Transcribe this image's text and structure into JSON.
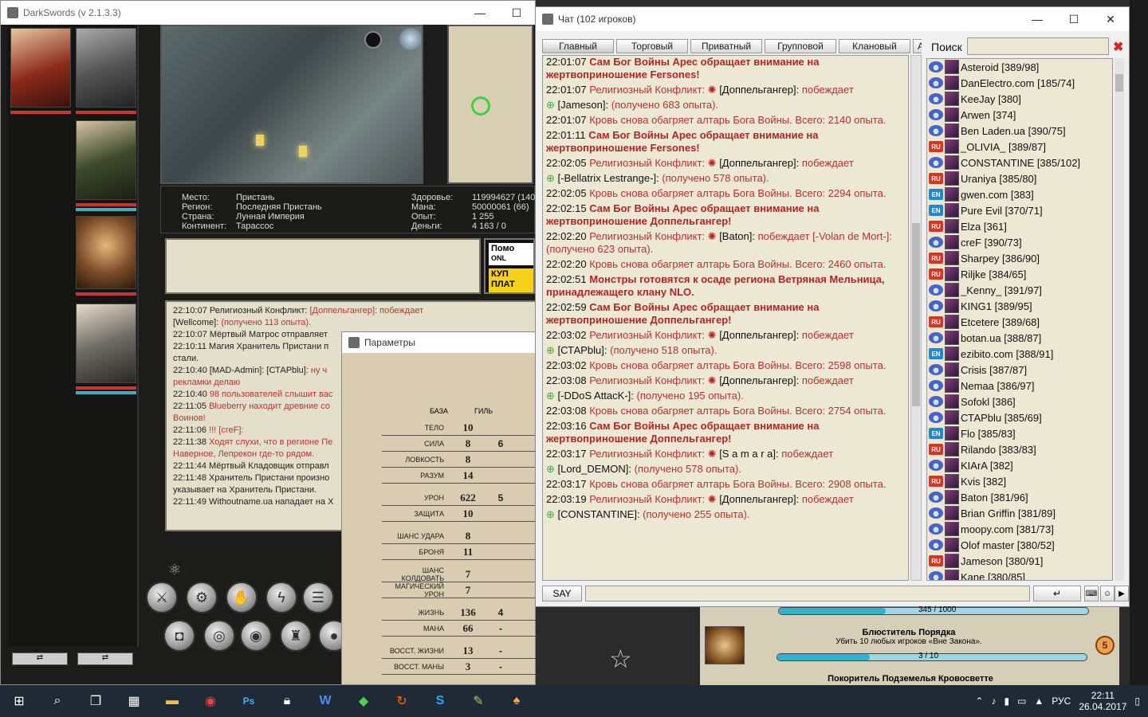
{
  "game": {
    "title": "DarkSwords (v 2.1.3.3)",
    "info": {
      "place_label": "Место:",
      "place": "Пристань",
      "region_label": "Регион:",
      "region": "Последняя Пристань",
      "country_label": "Страна:",
      "country": "Лунная Империя",
      "continent_label": "Континент:",
      "continent": "Тарассос",
      "health_label": "Здоровье:",
      "health": "119994627 (140)",
      "mana_label": "Мана:",
      "mana": "50000061 (66)",
      "exp_label": "Опыт:",
      "exp": "1 255",
      "money_label": "Деньги:",
      "money": "4 163 / 0"
    },
    "shop": {
      "line1": "Помо",
      "line2": "ONL",
      "line3": "КУП",
      "line4": "ПЛАТ"
    },
    "log": [
      {
        "text": "22:10:07 Религиозный Конфликт: ",
        "red": "[Доппельгангер]: побеждает"
      },
      {
        "text": "[Wellcome]: ",
        "red": "(получено 113 опыта)."
      },
      {
        "text": "22:10:07 Мёртвый Матрос отправляет",
        "red": ""
      },
      {
        "text": "22:10:11 Магия Хранитель Пристани п",
        "red": ""
      },
      {
        "text": "стали.",
        "red": ""
      },
      {
        "text": "22:10:40 [MAD-Admin]: [СТАРblu]: ",
        "red": "ну ч"
      },
      {
        "text": "",
        "red": "рекламки делаю"
      },
      {
        "text": "22:10:40 ",
        "red": "98 пользователей слышит вас"
      },
      {
        "text": "22:11:05 ",
        "red": "Blueberry находит древние со"
      },
      {
        "text": "",
        "red": "Воинов!"
      },
      {
        "text": "22:11:06 ",
        "red": "!!! [creF]:"
      },
      {
        "text": "22:11:38 ",
        "red": "Ходят слухи, что в регионе Пе"
      },
      {
        "text": "",
        "red": "Наверное, Лепрекон где-то рядом."
      },
      {
        "text": "22:11:44 Мёртвый Кладовщик отправл",
        "red": ""
      },
      {
        "text": "22:11:48 Хранитель Пристани произно",
        "red": ""
      },
      {
        "text": "указывает на Хранитель Пристани.",
        "red": ""
      },
      {
        "text": "22:11:49 Withoutname.ua нападает на Х",
        "red": ""
      }
    ]
  },
  "params": {
    "title": "Параметры",
    "col_base": "БАЗА",
    "col_guild": "ГИЛЬ",
    "rows": [
      {
        "label": "ТЕЛО",
        "base": "10",
        "guild": ""
      },
      {
        "label": "СИЛА",
        "base": "8",
        "guild": "6"
      },
      {
        "label": "ЛОВКОСТЬ",
        "base": "8",
        "guild": ""
      },
      {
        "label": "РАЗУМ",
        "base": "14",
        "guild": ""
      },
      {
        "label": "",
        "base": "",
        "guild": ""
      },
      {
        "label": "УРОН",
        "base": "622",
        "guild": "5"
      },
      {
        "label": "ЗАЩИТА",
        "base": "10",
        "guild": ""
      },
      {
        "label": "",
        "base": "",
        "guild": ""
      },
      {
        "label": "ШАНС УДАРА",
        "base": "8",
        "guild": ""
      },
      {
        "label": "БРОНЯ",
        "base": "11",
        "guild": ""
      },
      {
        "label": "",
        "base": "",
        "guild": ""
      },
      {
        "label": "ШАНС КОЛДОВАТЬ",
        "base": "7",
        "guild": ""
      },
      {
        "label": "МАГИЧЕСКИЙ УРОН",
        "base": "7",
        "guild": ""
      },
      {
        "label": "",
        "base": "",
        "guild": ""
      },
      {
        "label": "ЖИЗНЬ",
        "base": "136",
        "guild": "4"
      },
      {
        "label": "МАНА",
        "base": "66",
        "guild": "-"
      },
      {
        "label": "",
        "base": "",
        "guild": ""
      },
      {
        "label": "ВОССТ. ЖИЗНИ",
        "base": "13",
        "guild": "-"
      },
      {
        "label": "ВОССТ. МАНЫ",
        "base": "3",
        "guild": "-"
      }
    ]
  },
  "chat": {
    "title": "Чат (102 игроков)",
    "tabs": [
      "Главный",
      "Торговый",
      "Приватный",
      "Групповой",
      "Клановый",
      "А"
    ],
    "search_label": "Поиск",
    "say_label": "SAY",
    "messages": [
      {
        "time": "22:01:07",
        "kind": "red",
        "text": "Сам Бог Войны Арес обращает внимание на жертвоприношение Fersones!"
      },
      {
        "time": "22:01:07",
        "kind": "dark",
        "text": "Религиозный Конфликт:",
        "name": "[Доппельгангер]:",
        "tail": "побеждает"
      },
      {
        "time": "",
        "kind": "dark",
        "text": "",
        "name": "[Jameson]:",
        "tail": "(получено 683 опыта)."
      },
      {
        "time": "22:01:07",
        "kind": "dark",
        "text": "Кровь снова обагряет алтарь Бога Войны. Всего: 2140 опыта."
      },
      {
        "time": "22:01:11",
        "kind": "red",
        "text": "Сам Бог Войны Арес обращает внимание на жертвоприношение Fersones!"
      },
      {
        "time": "22:02:05",
        "kind": "dark",
        "text": "Религиозный Конфликт:",
        "name": "[Доппельгангер]:",
        "tail": "побеждает"
      },
      {
        "time": "",
        "kind": "dark",
        "text": "",
        "name": "[-Bellatrix Lestrange-]:",
        "tail": "(получено 578 опыта)."
      },
      {
        "time": "22:02:05",
        "kind": "dark",
        "text": "Кровь снова обагряет алтарь Бога Войны. Всего: 2294 опыта."
      },
      {
        "time": "22:02:15",
        "kind": "red",
        "text": "Сам Бог Войны Арес обращает внимание на жертвоприношение Доппельгангер!"
      },
      {
        "time": "22:02:20",
        "kind": "dark",
        "text": "Религиозный Конфликт:",
        "name": "[Baton]:",
        "tail": "побеждает [-Volan de Mort-]: (получено 623 опыта)."
      },
      {
        "time": "22:02:20",
        "kind": "dark",
        "text": "Кровь снова обагряет алтарь Бога Войны. Всего: 2460 опыта."
      },
      {
        "time": "22:02:51",
        "kind": "red",
        "text": "Монстры готовятся к осаде региона Ветряная Мельница, принадлежащего клану NLO."
      },
      {
        "time": "22:02:59",
        "kind": "red",
        "text": "Сам Бог Войны Арес обращает внимание на жертвоприношение Доппельгангер!"
      },
      {
        "time": "22:03:02",
        "kind": "dark",
        "text": "Религиозный Конфликт:",
        "name": "[Доппельгангер]:",
        "tail": "побеждает"
      },
      {
        "time": "",
        "kind": "dark",
        "text": "",
        "name": "[СТАРblu]:",
        "tail": "(получено 518 опыта)."
      },
      {
        "time": "22:03:02",
        "kind": "dark",
        "text": "Кровь снова обагряет алтарь Бога Войны. Всего: 2598 опыта."
      },
      {
        "time": "22:03:08",
        "kind": "dark",
        "text": "Религиозный Конфликт:",
        "name": "[Доппельгангер]:",
        "tail": "побеждает"
      },
      {
        "time": "",
        "kind": "dark",
        "text": "",
        "name": "[-DDoS AttacK-]:",
        "tail": "(получено 195 опыта)."
      },
      {
        "time": "22:03:08",
        "kind": "dark",
        "text": "Кровь снова обагряет алтарь Бога Войны. Всего: 2754 опыта."
      },
      {
        "time": "22:03:16",
        "kind": "red",
        "text": "Сам Бог Войны Арес обращает внимание на жертвоприношение Доппельгангер!"
      },
      {
        "time": "22:03:17",
        "kind": "dark",
        "text": "Религиозный Конфликт:",
        "name": "[S a m a r a]:",
        "tail": "побеждает"
      },
      {
        "time": "",
        "kind": "dark",
        "text": "",
        "name": "[Lord_DEMON]:",
        "tail": "(получено 578 опыта)."
      },
      {
        "time": "22:03:17",
        "kind": "dark",
        "text": "Кровь снова обагряет алтарь Бога Войны. Всего: 2908 опыта."
      },
      {
        "time": "22:03:19",
        "kind": "dark",
        "text": "Религиозный Конфликт:",
        "name": "[Доппельгангер]:",
        "tail": "побеждает"
      },
      {
        "time": "",
        "kind": "dark",
        "text": "",
        "name": "[CONSTANTINE]:",
        "tail": "(получено 255 опыта)."
      }
    ],
    "players": [
      {
        "flag": "gl",
        "name": "Asteroid [389/98]"
      },
      {
        "flag": "gl",
        "name": "DanElectro.com [185/74]"
      },
      {
        "flag": "gl",
        "name": "KeeJay [380]"
      },
      {
        "flag": "gl",
        "name": "Arwen [374]"
      },
      {
        "flag": "gl",
        "name": "Ben Laden.ua [390/75]"
      },
      {
        "flag": "ru",
        "name": "_OLIVIA_ [389/87]"
      },
      {
        "flag": "gl",
        "name": "CONSTANTINE [385/102]"
      },
      {
        "flag": "ru",
        "name": "Uraniya [385/80]"
      },
      {
        "flag": "en",
        "name": "gwen.com [383]"
      },
      {
        "flag": "en",
        "name": "Pure Evil [370/71]"
      },
      {
        "flag": "ru",
        "name": "Elza [361]"
      },
      {
        "flag": "gl",
        "name": "creF [390/73]"
      },
      {
        "flag": "ru",
        "name": "Sharpey [386/90]"
      },
      {
        "flag": "ru",
        "name": "Riljke [384/65]"
      },
      {
        "flag": "gl",
        "name": "_Kenny_ [391/97]"
      },
      {
        "flag": "gl",
        "name": "KING1 [389/95]"
      },
      {
        "flag": "ru",
        "name": "Etcetere [389/68]"
      },
      {
        "flag": "gl",
        "name": "botan.ua [388/87]"
      },
      {
        "flag": "en",
        "name": "ezibito.com [388/91]"
      },
      {
        "flag": "gl",
        "name": "Crisis [387/87]"
      },
      {
        "flag": "gl",
        "name": "Nemaa [386/97]"
      },
      {
        "flag": "gl",
        "name": "Sofokl [386]"
      },
      {
        "flag": "gl",
        "name": "СТАРblu [385/69]"
      },
      {
        "flag": "en",
        "name": "Flo [385/83]"
      },
      {
        "flag": "ru",
        "name": "Rilando [383/83]"
      },
      {
        "flag": "gl",
        "name": "KIArA [382]"
      },
      {
        "flag": "ru",
        "name": "Kvis [382]"
      },
      {
        "flag": "gl",
        "name": "Baton [381/96]"
      },
      {
        "flag": "gl",
        "name": "Brian Griffin [381/89]"
      },
      {
        "flag": "gl",
        "name": "moopy.com [381/73]"
      },
      {
        "flag": "gl",
        "name": "Olof master [380/52]"
      },
      {
        "flag": "ru",
        "name": "Jameson [380/91]"
      },
      {
        "flag": "gl",
        "name": "Kane [380/85]"
      }
    ]
  },
  "quests": {
    "q1_progress": "345 / 1000",
    "q1_fraction": 0.345,
    "q2_title": "Блюститель Порядка",
    "q2_desc": "Убить 10 любых игроков «Вне Закона».",
    "q2_progress": "3 / 10",
    "q2_fraction": 0.3,
    "q2_count": "5",
    "q3_title": "Покоритель Подземелья Кровосветте"
  },
  "taskbar": {
    "lang": "РУС",
    "time": "22:11",
    "date": "26.04.2017"
  }
}
